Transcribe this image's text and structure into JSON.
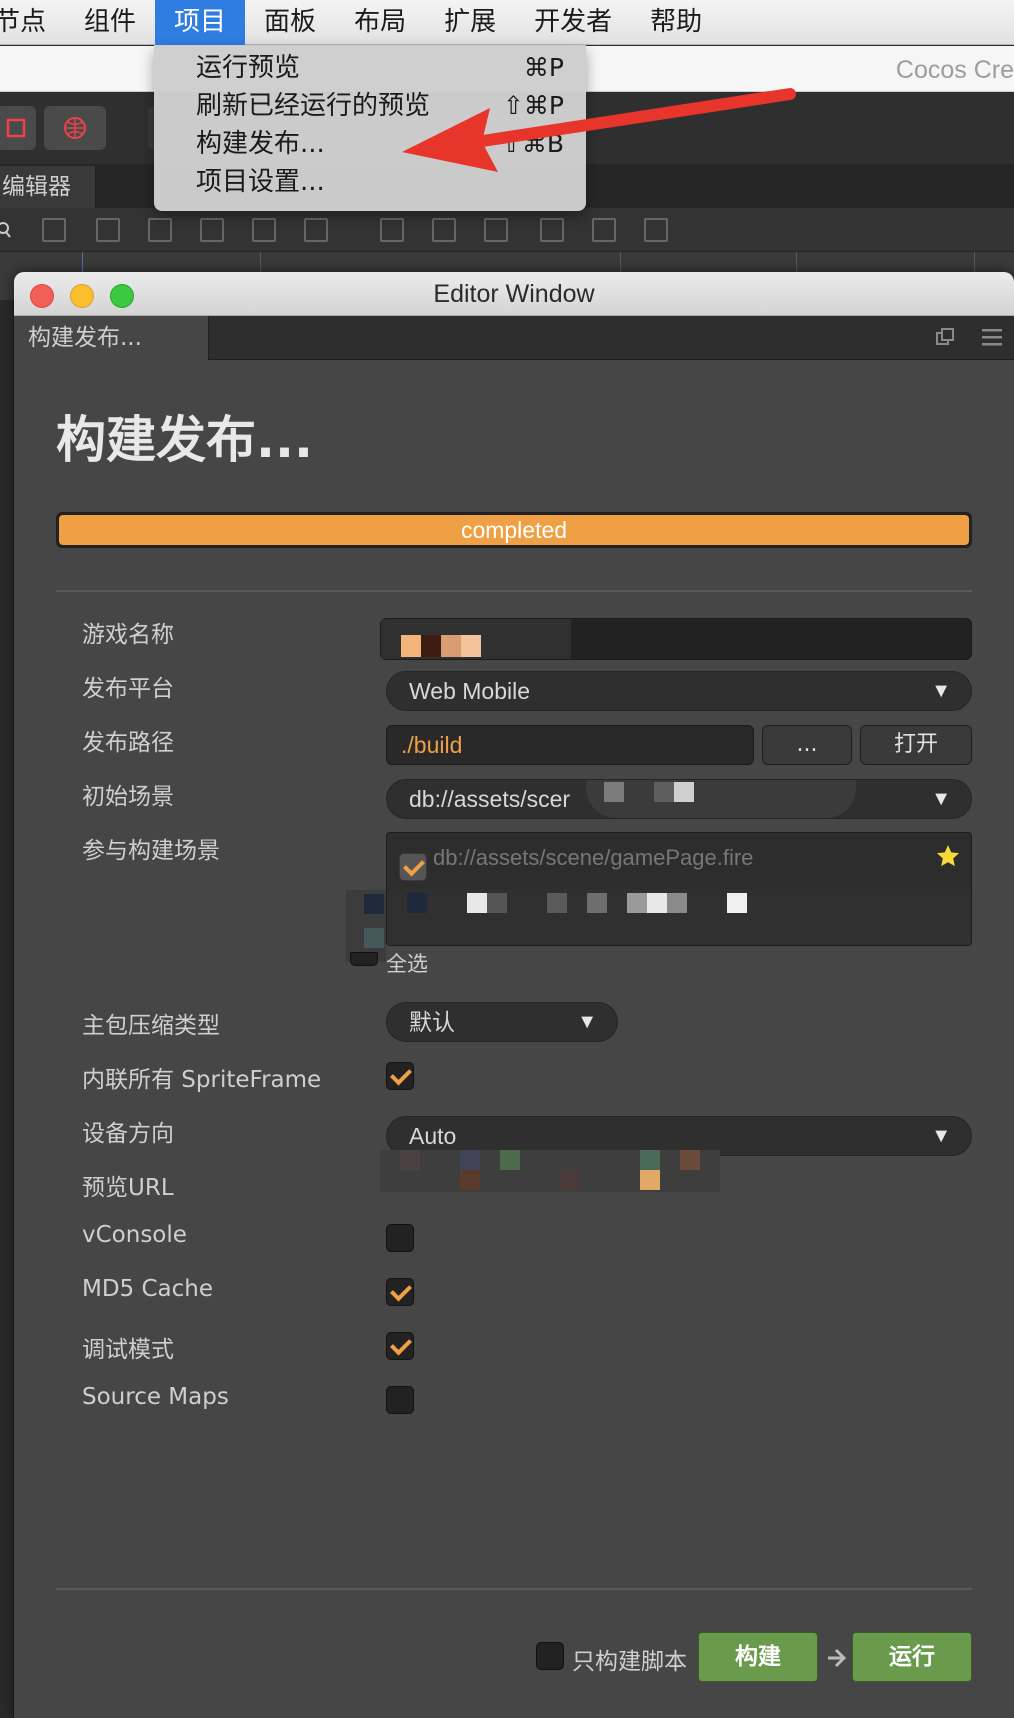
{
  "menubar": {
    "items": [
      "节点",
      "组件",
      "项目",
      "面板",
      "布局",
      "扩展",
      "开发者",
      "帮助"
    ],
    "active_index": 2
  },
  "app_title": "Cocos Cre",
  "scene_editor_tab": "编辑器",
  "project_menu": {
    "items": [
      {
        "label": "运行预览",
        "shortcut": "⌘P"
      },
      {
        "label": "刷新已经运行的预览",
        "shortcut": "⇧⌘P"
      },
      {
        "label": "构建发布...",
        "shortcut": "⇧⌘B"
      },
      {
        "label": "项目设置...",
        "shortcut": ""
      }
    ]
  },
  "editor_window": {
    "title": "Editor Window",
    "tab_label": "构建发布...",
    "heading": "构建发布...",
    "progress": {
      "label": "completed",
      "percent": 100,
      "color": "#f0a044"
    }
  },
  "build_form": {
    "game_name": {
      "label": "游戏名称",
      "value": ""
    },
    "platform": {
      "label": "发布平台",
      "value": "Web Mobile"
    },
    "build_path": {
      "label": "发布路径",
      "value": "./build",
      "browse_label": "...",
      "open_label": "打开"
    },
    "start_scene": {
      "label": "初始场景",
      "value": "db://assets/scer"
    },
    "included_scenes": {
      "label": "参与构建场景",
      "items": [
        "db://assets/scene/gamePage.fire"
      ],
      "select_all_label": "全选"
    },
    "compression": {
      "label": "主包压缩类型",
      "value": "默认"
    },
    "inline_spriteframe": {
      "label": "内联所有 SpriteFrame",
      "checked": true
    },
    "orientation": {
      "label": "设备方向",
      "value": "Auto"
    },
    "preview_url": {
      "label": "预览URL"
    },
    "vconsole": {
      "label": "vConsole",
      "checked": false
    },
    "md5_cache": {
      "label": "MD5 Cache",
      "checked": true
    },
    "debug_mode": {
      "label": "调试模式",
      "checked": true
    },
    "source_maps": {
      "label": "Source Maps",
      "checked": false
    }
  },
  "footer": {
    "script_only_label": "只构建脚本",
    "build_label": "构建",
    "run_label": "运行"
  },
  "colors": {
    "accent_orange": "#f0a044",
    "action_green": "#6a9a4c",
    "annotation_red": "#e8352c",
    "menu_highlight": "#2f7de1"
  }
}
